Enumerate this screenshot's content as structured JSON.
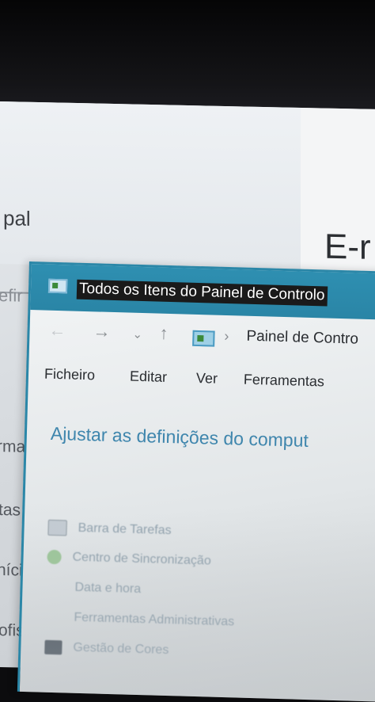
{
  "background_window": {
    "left_fragments": [
      "pal",
      "efir",
      "rma",
      "tas",
      "níci",
      "ofis"
    ],
    "right_title_fragment": "E-r"
  },
  "window": {
    "title": "Todos os Itens do Painel de Controlo",
    "title_icon": "control-panel-icon"
  },
  "navigation": {
    "back_icon": "arrow-left-icon",
    "forward_icon": "arrow-right-icon",
    "recent_icon": "chevron-down-icon",
    "up_icon": "arrow-up-icon",
    "address": "Painel de Contro"
  },
  "menu": {
    "items": [
      "Ficheiro",
      "Editar",
      "Ver",
      "Ferramentas"
    ]
  },
  "content": {
    "heading": "Ajustar as definições do comput",
    "items": [
      {
        "label": "Barra de Tarefas",
        "icon": "taskbar-icon"
      },
      {
        "label": "Centro de Sincronização",
        "icon": "sync-center-icon"
      },
      {
        "label": "Data e hora",
        "icon": "date-time-icon"
      },
      {
        "label": "Ferramentas Administrativas",
        "icon": "admin-tools-icon"
      },
      {
        "label": "Gestão de Cores",
        "icon": "color-management-icon"
      }
    ]
  },
  "colors": {
    "titlebar": "#2b87a8",
    "heading": "#3f86ad"
  }
}
